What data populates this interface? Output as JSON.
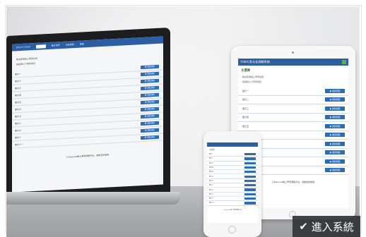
{
  "laptop": {
    "nav": [
      "ENTITY SCAN",
      "搜尋",
      "關於我們",
      "常見問題",
      "客服"
    ],
    "intro": [
      "歡迎使用線上學習系統",
      "請選擇以下學習項目"
    ],
    "rows": [
      "單元一",
      "單元二",
      "單元三",
      "單元四",
      "單元五",
      "單元六",
      "單元七",
      "單元八",
      "單元九",
      "單元十",
      "單元十一"
    ],
    "button_label": "▶ 開始測驗",
    "footer": "© Easy test線上學習測驗平台，感謝您的使用"
  },
  "tablet": {
    "title": "TOEIC多元化測驗系統",
    "subtitle": "主選單",
    "intro": [
      "歡迎使用線上學習系統",
      "請選擇以下學習項目"
    ],
    "rows": [
      "單元一",
      "單元二",
      "單元三",
      "單元四",
      "單元五",
      "單元六",
      "單元七",
      "單元八",
      "單元九",
      "單元十"
    ],
    "button_label": "▶ 開始測驗",
    "footer": "© Easy test線上學習測驗平台，感謝您的使用"
  },
  "phone": {
    "subtitle": "主選單",
    "rows": [
      "單元一",
      "單元二",
      "單元三",
      "單元四",
      "單元五",
      "單元六",
      "單元七",
      "單元八",
      "單元九",
      "單元十",
      "單元十一",
      "單元十二"
    ],
    "footer": "© Easy test線上學習測驗平台"
  },
  "enter_button": {
    "icon": "check-icon",
    "label": "進入系統",
    "background": "#30343a"
  },
  "colors": {
    "brand_blue": "#2a5fa8",
    "button_blue": "#2a6cbe",
    "accent_green": "#55b24d"
  }
}
